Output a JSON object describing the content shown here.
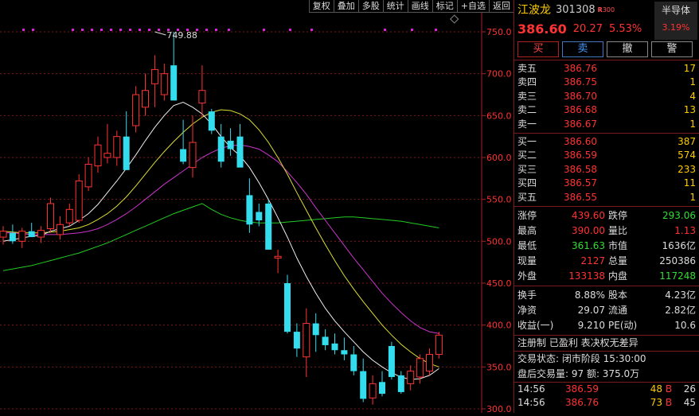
{
  "toolbar": {
    "items": [
      "复权",
      "叠加",
      "多股",
      "统计",
      "画线",
      "标记",
      "+自选",
      "返回"
    ]
  },
  "chart_data": {
    "type": "candlestick",
    "y_ticks": [
      "750.0",
      "700.0",
      "650.0",
      "600.0",
      "550.0",
      "500.0",
      "450.0",
      "400.0",
      "350.0",
      "300.0"
    ],
    "ylim": [
      300,
      760
    ],
    "annotation": "749.88",
    "candles": [
      {
        "o": 505,
        "h": 518,
        "l": 496,
        "c": 512
      },
      {
        "o": 510,
        "h": 520,
        "l": 497,
        "c": 500
      },
      {
        "o": 500,
        "h": 516,
        "l": 492,
        "c": 512
      },
      {
        "o": 512,
        "h": 522,
        "l": 505,
        "c": 505
      },
      {
        "o": 505,
        "h": 518,
        "l": 498,
        "c": 513
      },
      {
        "o": 515,
        "h": 552,
        "l": 510,
        "c": 545
      },
      {
        "o": 508,
        "h": 530,
        "l": 502,
        "c": 520
      },
      {
        "o": 522,
        "h": 545,
        "l": 518,
        "c": 538
      },
      {
        "o": 525,
        "h": 580,
        "l": 522,
        "c": 572
      },
      {
        "o": 565,
        "h": 600,
        "l": 560,
        "c": 592
      },
      {
        "o": 590,
        "h": 625,
        "l": 582,
        "c": 615
      },
      {
        "o": 600,
        "h": 640,
        "l": 593,
        "c": 605
      },
      {
        "o": 600,
        "h": 632,
        "l": 590,
        "c": 625
      },
      {
        "o": 625,
        "h": 655,
        "l": 585,
        "c": 585
      },
      {
        "o": 638,
        "h": 685,
        "l": 630,
        "c": 675
      },
      {
        "o": 660,
        "h": 700,
        "l": 650,
        "c": 680
      },
      {
        "o": 688,
        "h": 722,
        "l": 660,
        "c": 705
      },
      {
        "o": 675,
        "h": 712,
        "l": 668,
        "c": 700
      },
      {
        "o": 710,
        "h": 750,
        "l": 668,
        "c": 668
      },
      {
        "o": 610,
        "h": 645,
        "l": 592,
        "c": 595
      },
      {
        "o": 588,
        "h": 650,
        "l": 576,
        "c": 618
      },
      {
        "o": 665,
        "h": 710,
        "l": 648,
        "c": 680
      },
      {
        "o": 655,
        "h": 658,
        "l": 628,
        "c": 632
      },
      {
        "o": 625,
        "h": 640,
        "l": 588,
        "c": 595
      },
      {
        "o": 620,
        "h": 635,
        "l": 602,
        "c": 610
      },
      {
        "o": 625,
        "h": 640,
        "l": 590,
        "c": 588
      },
      {
        "o": 555,
        "h": 575,
        "l": 510,
        "c": 520
      },
      {
        "o": 535,
        "h": 545,
        "l": 518,
        "c": 525
      },
      {
        "o": 545,
        "h": 550,
        "l": 490,
        "c": 490
      },
      {
        "o": 480,
        "h": 490,
        "l": 462,
        "c": 482
      },
      {
        "o": 450,
        "h": 460,
        "l": 390,
        "c": 392
      },
      {
        "o": 392,
        "h": 402,
        "l": 362,
        "c": 372
      },
      {
        "o": 362,
        "h": 420,
        "l": 338,
        "c": 402
      },
      {
        "o": 402,
        "h": 414,
        "l": 368,
        "c": 388
      },
      {
        "o": 386,
        "h": 395,
        "l": 370,
        "c": 376
      },
      {
        "o": 378,
        "h": 390,
        "l": 365,
        "c": 370
      },
      {
        "o": 370,
        "h": 385,
        "l": 358,
        "c": 365
      },
      {
        "o": 365,
        "h": 375,
        "l": 340,
        "c": 345
      },
      {
        "o": 345,
        "h": 360,
        "l": 308,
        "c": 312
      },
      {
        "o": 313,
        "h": 340,
        "l": 305,
        "c": 330
      },
      {
        "o": 332,
        "h": 345,
        "l": 315,
        "c": 318
      },
      {
        "o": 375,
        "h": 380,
        "l": 335,
        "c": 338
      },
      {
        "o": 340,
        "h": 345,
        "l": 318,
        "c": 320
      },
      {
        "o": 330,
        "h": 352,
        "l": 322,
        "c": 345
      },
      {
        "o": 338,
        "h": 365,
        "l": 330,
        "c": 360
      },
      {
        "o": 345,
        "h": 372,
        "l": 340,
        "c": 365
      },
      {
        "o": 365,
        "h": 392,
        "l": 360,
        "c": 388
      }
    ],
    "ma_white": [
      500,
      502,
      504,
      506,
      507,
      512,
      515,
      518,
      525,
      533,
      544,
      558,
      572,
      587,
      603,
      620,
      636,
      650,
      662,
      666,
      660,
      652,
      640,
      625,
      612,
      602,
      588,
      570,
      550,
      528,
      505,
      480,
      458,
      438,
      420,
      405,
      392,
      380,
      368,
      358,
      350,
      343,
      338,
      335,
      336,
      340,
      348
    ],
    "ma_yellow": [
      512,
      511,
      510,
      510,
      510,
      511,
      512,
      514,
      516,
      520,
      526,
      533,
      542,
      553,
      566,
      580,
      594,
      607,
      619,
      630,
      640,
      648,
      654,
      657,
      656,
      652,
      645,
      633,
      618,
      600,
      580,
      558,
      537,
      516,
      496,
      477,
      459,
      443,
      428,
      414,
      400,
      388,
      377,
      368,
      360,
      354,
      350
    ],
    "ma_magenta": [
      510,
      510,
      509,
      508,
      508,
      508,
      508,
      509,
      510,
      512,
      515,
      520,
      526,
      533,
      541,
      550,
      559,
      568,
      576,
      584,
      592,
      600,
      606,
      611,
      614,
      615,
      613,
      610,
      603,
      595,
      583,
      570,
      556,
      540,
      525,
      510,
      495,
      480,
      466,
      452,
      438,
      426,
      415,
      405,
      397,
      392,
      390
    ],
    "ma_green": [
      465,
      467,
      469,
      471,
      474,
      477,
      480,
      483,
      486,
      490,
      494,
      498,
      503,
      508,
      513,
      518,
      523,
      528,
      533,
      537,
      541,
      545,
      538,
      532,
      528,
      525,
      523,
      522,
      522,
      522,
      523,
      524,
      525,
      526,
      527,
      528,
      529,
      529,
      528,
      527,
      526,
      525,
      524,
      522,
      520,
      518,
      516
    ]
  },
  "quote": {
    "name": "江波龙",
    "code": "301308",
    "badge": "R",
    "badge_sub": "300",
    "sector": "半导体",
    "sector_change": "3.19%",
    "price": "386.60",
    "change": "20.27",
    "change_pct": "5.53%"
  },
  "orders": {
    "buy": "买",
    "sell": "卖",
    "withdraw": "撤",
    "alert": "警"
  },
  "asks": [
    {
      "label": "卖五",
      "price": "386.76",
      "vol": "17"
    },
    {
      "label": "卖四",
      "price": "386.75",
      "vol": "1"
    },
    {
      "label": "卖三",
      "price": "386.70",
      "vol": "4"
    },
    {
      "label": "卖二",
      "price": "386.68",
      "vol": "13"
    },
    {
      "label": "卖一",
      "price": "386.67",
      "vol": "1"
    }
  ],
  "bids": [
    {
      "label": "买一",
      "price": "386.60",
      "vol": "387"
    },
    {
      "label": "买二",
      "price": "386.59",
      "vol": "574"
    },
    {
      "label": "买三",
      "price": "386.58",
      "vol": "233"
    },
    {
      "label": "买四",
      "price": "386.57",
      "vol": "11"
    },
    {
      "label": "买五",
      "price": "386.55",
      "vol": "1"
    }
  ],
  "stats": [
    {
      "k1": "涨停",
      "v1": "439.60",
      "c1": "red",
      "k2": "跌停",
      "v2": "293.06",
      "c2": "grn"
    },
    {
      "k1": "最高",
      "v1": "390.00",
      "c1": "red",
      "k2": "量比",
      "v2": "1.13",
      "c2": "red"
    },
    {
      "k1": "最低",
      "v1": "361.63",
      "c1": "grn",
      "k2": "市值",
      "v2": "1636亿",
      "c2": "wht"
    },
    {
      "k1": "现量",
      "v1": "2127",
      "c1": "red",
      "k2": "总量",
      "v2": "250386",
      "c2": "wht"
    },
    {
      "k1": "外盘",
      "v1": "133138",
      "c1": "red",
      "k2": "内盘",
      "v2": "117248",
      "c2": "grn"
    }
  ],
  "fundamentals": [
    {
      "k1": "换手",
      "v1": "8.88%",
      "k2": "股本",
      "v2": "4.23亿"
    },
    {
      "k1": "净资",
      "v1": "29.07",
      "k2": "流通",
      "v2": "2.82亿"
    },
    {
      "k1": "收益(一)",
      "v1": "9.210",
      "k2": "PE(动)",
      "v2": "10.6"
    }
  ],
  "status": {
    "tags": "注册制 已盈利 表决权无差异",
    "trade_state": "交易状态: 闭市阶段 15:30:00",
    "after_hours": "盘后交易量: 97  额: 375.0万"
  },
  "ticks": [
    {
      "time": "14:56",
      "price": "386.59",
      "vol": "48",
      "bs": "B",
      "n": "26"
    },
    {
      "time": "14:56",
      "price": "386.76",
      "vol": "73",
      "bs": "B",
      "n": "45"
    }
  ]
}
